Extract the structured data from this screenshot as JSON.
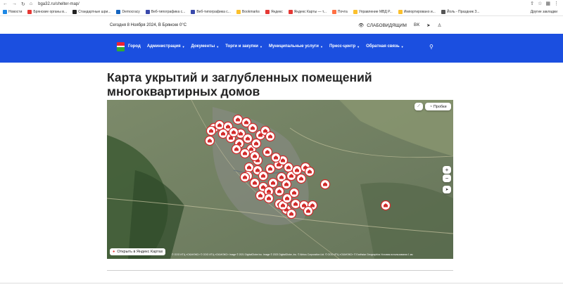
{
  "browser": {
    "back": "←",
    "forward": "→",
    "reload": "↻",
    "home": "⌂",
    "url": "bga32.ru/shelter-map/"
  },
  "bookmarks": [
    {
      "label": "Новости",
      "color": "#1e88e5"
    },
    {
      "label": "Брянские органы в...",
      "color": "#e53935"
    },
    {
      "label": "Стандартные шри...",
      "color": "#222222"
    },
    {
      "label": "Democracy",
      "color": "#1565c0"
    },
    {
      "label": "Веб-типографика с...",
      "color": "#3949ab"
    },
    {
      "label": "Веб-типографика с...",
      "color": "#3949ab"
    },
    {
      "label": "Bookmarks",
      "color": "#fbc02d"
    },
    {
      "label": "Яндекс",
      "color": "#e53935"
    },
    {
      "label": "Яндекс Карты — т...",
      "color": "#e53935"
    },
    {
      "label": "Почта",
      "color": "#ff7043"
    },
    {
      "label": "Управление МВД Р...",
      "color": "#fbc02d"
    },
    {
      "label": "Импортировано и...",
      "color": "#fbc02d"
    },
    {
      "label": "Йоль - Праздник З...",
      "color": "#555555"
    }
  ],
  "bookmarks_other": "Другие закладки",
  "site": {
    "date_line": "Сегодня 8 Ноября 2024, В Брянске 0°C",
    "accessibility": "СЛАБОВИДЯЩИМ",
    "social_vk": "vk",
    "social_tg": "tg",
    "social_ok": "ok",
    "menu": [
      "Город",
      "Администрация",
      "Документы",
      "Торги и закупки",
      "Муниципальные услуги",
      "Пресс-центр",
      "Обратная связь"
    ],
    "heading_line1": "Карта укрытий и заглубленных помещений",
    "heading_line2": "многоквартирных домов"
  },
  "map": {
    "traffic_button": "Пробки",
    "zoom_in": "+",
    "zoom_out": "−",
    "open_in_yandex": "Открыть в Яндекс Картах",
    "copyright": "© ООО ИТЦ «СКАНЭКС» © ООО ИТЦ «СКАНЭКС» Image © 2021 DigitalGlobe Inc. Image © 2023 DigitalGlobe, Inc. © Airbus Corporation Ltd. © ООО ИТЦ «СКАНЭКС» © Earthstar Geographics   Условия использования   1 км",
    "colors": {
      "marker_fill": "#d32b2b",
      "marker_ring": "#ffffff"
    }
  }
}
